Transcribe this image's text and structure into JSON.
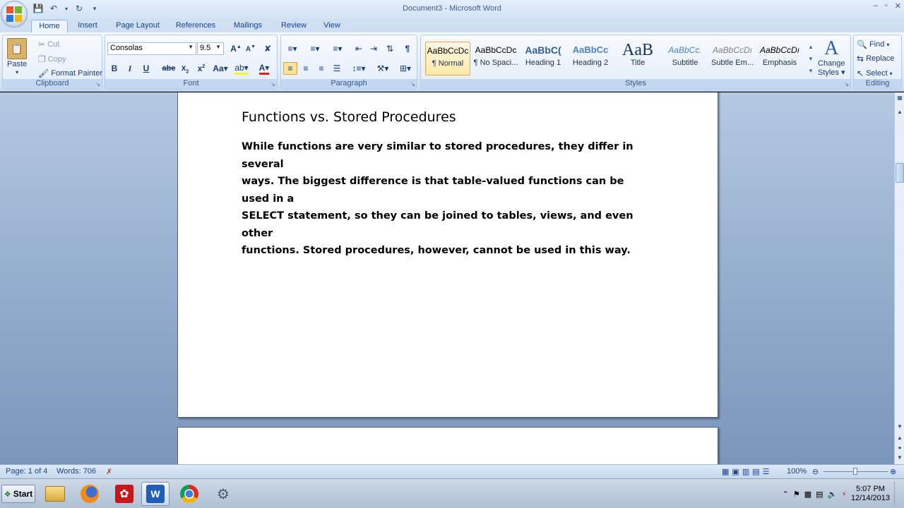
{
  "window": {
    "title": "Document3 - Microsoft Word",
    "controls": [
      "–",
      "▫",
      "✕"
    ]
  },
  "tabs": [
    {
      "label": "Home",
      "active": true
    },
    {
      "label": "Insert"
    },
    {
      "label": "Page Layout"
    },
    {
      "label": "References"
    },
    {
      "label": "Mailings"
    },
    {
      "label": "Review"
    },
    {
      "label": "View"
    }
  ],
  "clipboard": {
    "paste_label": "Paste",
    "cut_label": "Cut",
    "copy_label": "Copy",
    "format_painter_label": "Format Painter",
    "group_label": "Clipboard"
  },
  "font": {
    "family": "Consolas",
    "size": "9.5",
    "group_label": "Font"
  },
  "paragraph": {
    "group_label": "Paragraph"
  },
  "styles": {
    "group_label": "Styles",
    "change_styles_line1": "Change",
    "change_styles_line2": "Styles",
    "items": [
      {
        "preview": "AaBbCcDc",
        "name": "¶ Normal"
      },
      {
        "preview": "AaBbCcDc",
        "name": "¶ No Spaci..."
      },
      {
        "preview": "AaBbC(",
        "name": "Heading 1"
      },
      {
        "preview": "AaBbCc",
        "name": "Heading 2"
      },
      {
        "preview": "AaB",
        "name": "Title"
      },
      {
        "preview": "AaBbCc.",
        "name": "Subtitle"
      },
      {
        "preview": "AaBbCcDı",
        "name": "Subtle Em..."
      },
      {
        "preview": "AaBbCcDı",
        "name": "Emphasis"
      }
    ]
  },
  "editing": {
    "find_label": "Find",
    "replace_label": "Replace",
    "select_label": "Select",
    "group_label": "Editing"
  },
  "document": {
    "heading": "Functions vs. Stored Procedures",
    "paragraph_lines": [
      "While functions are very similar to stored procedures, they differ in several",
      "ways. The biggest difference is that table-valued functions can be used in a",
      "SELECT statement, so they can be joined to tables, views, and even other",
      "functions. Stored procedures, however, cannot be used in this way."
    ]
  },
  "status": {
    "page": "Page: 1 of 4",
    "words": "Words: 706",
    "zoom": "100%"
  },
  "taskbar": {
    "start_label": "Start",
    "time": "5:07 PM",
    "date": "12/14/2013"
  }
}
